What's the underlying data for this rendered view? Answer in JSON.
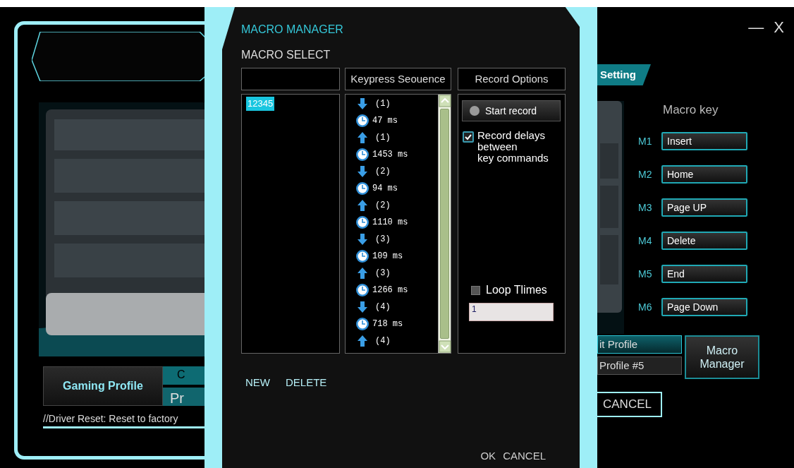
{
  "window": {
    "controls": [
      "—",
      "X"
    ]
  },
  "background": {
    "setting_tab": "Setting",
    "profile_button": "Gaming Profile",
    "profile_tabs": [
      "C",
      "Pr"
    ],
    "status": "//Driver Reset: Reset to factory",
    "macro_key_title": "Macro key",
    "macro_keys": [
      {
        "slot": "M1",
        "key": "Insert"
      },
      {
        "slot": "M2",
        "key": "Home"
      },
      {
        "slot": "M3",
        "key": "Page UP"
      },
      {
        "slot": "M4",
        "key": "Delete"
      },
      {
        "slot": "M5",
        "key": "End"
      },
      {
        "slot": "M6",
        "key": "Page Down"
      }
    ],
    "profile_buttons": [
      {
        "label": "it Profile",
        "selected": true
      },
      {
        "label": "Profile #5",
        "selected": false
      }
    ],
    "macro_manager_button": "Macro\nManager",
    "cancel_button": "CANCEL"
  },
  "dialog": {
    "title": "MACRO MANAGER",
    "section": "MACRO SELECT",
    "sequence_header": "Keypress Seouence",
    "options_header": "Record Options",
    "macros": [
      {
        "name": "12345",
        "selected": true
      }
    ],
    "sequence": [
      {
        "kind": "down",
        "text": "(1)"
      },
      {
        "kind": "delay",
        "text": "47 ms"
      },
      {
        "kind": "up",
        "text": "(1)"
      },
      {
        "kind": "delay",
        "text": "1453 ms"
      },
      {
        "kind": "down",
        "text": "(2)"
      },
      {
        "kind": "delay",
        "text": "94 ms"
      },
      {
        "kind": "up",
        "text": "(2)"
      },
      {
        "kind": "delay",
        "text": "1110 ms"
      },
      {
        "kind": "down",
        "text": "(3)"
      },
      {
        "kind": "delay",
        "text": "109 ms"
      },
      {
        "kind": "up",
        "text": "(3)"
      },
      {
        "kind": "delay",
        "text": "1266 ms"
      },
      {
        "kind": "down",
        "text": "(4)"
      },
      {
        "kind": "delay",
        "text": "718 ms"
      },
      {
        "kind": "up",
        "text": "(4)"
      }
    ],
    "start_record": "Start record",
    "record_delays": {
      "label": "Record delays\nbetween\nkey commands",
      "checked": true
    },
    "loop": {
      "label": "Loop Tlimes",
      "checked": false,
      "value": "1"
    },
    "actions": [
      "NEW",
      "DELETE"
    ],
    "footer": [
      "OK",
      "CANCEL"
    ]
  }
}
